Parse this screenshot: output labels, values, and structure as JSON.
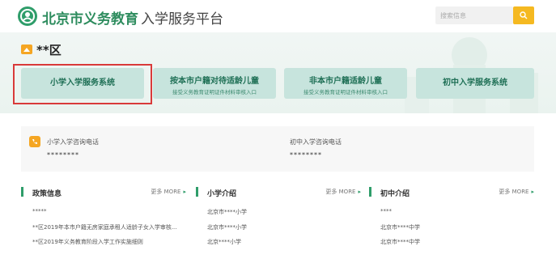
{
  "header": {
    "brand": "北京市义务教育",
    "brand_sub": "入学服务平台",
    "search_placeholder": "搜索信息"
  },
  "banner": {
    "region": "**区",
    "cards": [
      {
        "title": "小学入学服务系统",
        "subtitle": ""
      },
      {
        "title": "按本市户籍对待适龄儿童",
        "subtitle": "接受义务教育证明证件材料审核入口"
      },
      {
        "title": "非本市户籍适龄儿童",
        "subtitle": "接受义务教育证明证件材料审核入口"
      },
      {
        "title": "初中入学服务系统",
        "subtitle": ""
      }
    ]
  },
  "phones": {
    "primary_label": "小学入学咨询电话",
    "primary_number": "********",
    "middle_label": "初中入学咨询电话",
    "middle_number": "********"
  },
  "columns": [
    {
      "title": "政策信息",
      "more": "更多 MORE",
      "items": [
        "*****",
        "**区2019年本市户籍无房家庭承租人适龄子女入学审核...",
        "**区2019年义务教育阶段入学工作实施细则"
      ]
    },
    {
      "title": "小学介绍",
      "more": "更多 MORE",
      "items": [
        "北京市****小学",
        "北京市****小学",
        "北京****小学"
      ]
    },
    {
      "title": "初中介绍",
      "more": "更多 MORE",
      "items": [
        "****",
        "北京市****中学",
        "北京市****中学"
      ]
    }
  ],
  "colors": {
    "brand_green": "#2f9d6a",
    "card_bg": "#c7e4dd",
    "accent_yellow": "#f5b921",
    "highlight_red": "#d93a3a"
  }
}
